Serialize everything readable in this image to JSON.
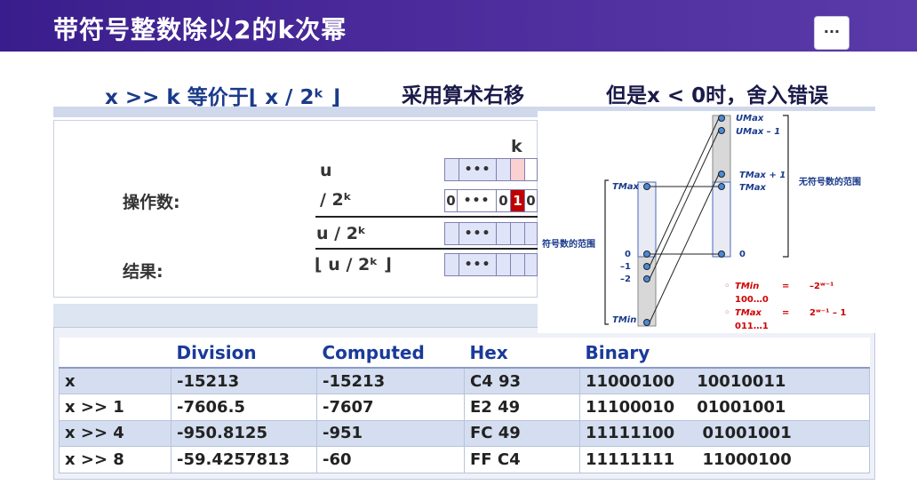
{
  "title": "带符号整数除以2的k次幂",
  "more_label": "···",
  "headings": {
    "equiv": "x >> k 等价于⌊ x / 2ᵏ ⌋",
    "arith": "采用算术右移",
    "error": "但是x < 0时，舍入错误"
  },
  "operands": {
    "k_label": "k",
    "u_label": "u",
    "operand_label": "操作数:",
    "div_label": "/  2ᵏ",
    "bits_div": [
      "0",
      "•••",
      "0",
      "1",
      "0"
    ],
    "u_div_label": "u / 2ᵏ",
    "result_label": "结果:",
    "floor_label": "⌊ u / 2ᵏ ⌋",
    "dots": "•••"
  },
  "diagram": {
    "umax": "UMax",
    "umax_minus1": "UMax – 1",
    "tmax_plus1": "TMax  + 1",
    "tmax_right": "TMax",
    "unsigned_range": "无符号数的范围",
    "tmax_left": "TMax",
    "signed_range": "符号数的范围",
    "zero_left": "0",
    "minus1": "–1",
    "minus2": "–2",
    "zero_right": "0",
    "tmin_left": "TMin",
    "note_tmin": "TMin",
    "note_eq1": "=",
    "note_val1": "–2ʷ⁻¹",
    "note_bin1": "100…0",
    "note_tmax": "TMax",
    "note_eq2": "=",
    "note_val2": "2ʷ⁻¹ – 1",
    "note_bin2": "011…1"
  },
  "table": {
    "headers": [
      "",
      "Division",
      "Computed",
      "Hex",
      "Binary"
    ],
    "rows": [
      [
        "x",
        "-15213",
        "-15213",
        "C4 93",
        "11000100    10010011"
      ],
      [
        "x >> 1",
        "-7606.5",
        "-7607",
        "E2 49",
        "11100010    01001001"
      ],
      [
        "x >> 4",
        "-950.8125",
        "-951",
        "FC 49",
        "11111100     01001001"
      ],
      [
        "x >> 8",
        "-59.4257813",
        "-60",
        "FF C4",
        "11111111     11000100"
      ]
    ]
  }
}
